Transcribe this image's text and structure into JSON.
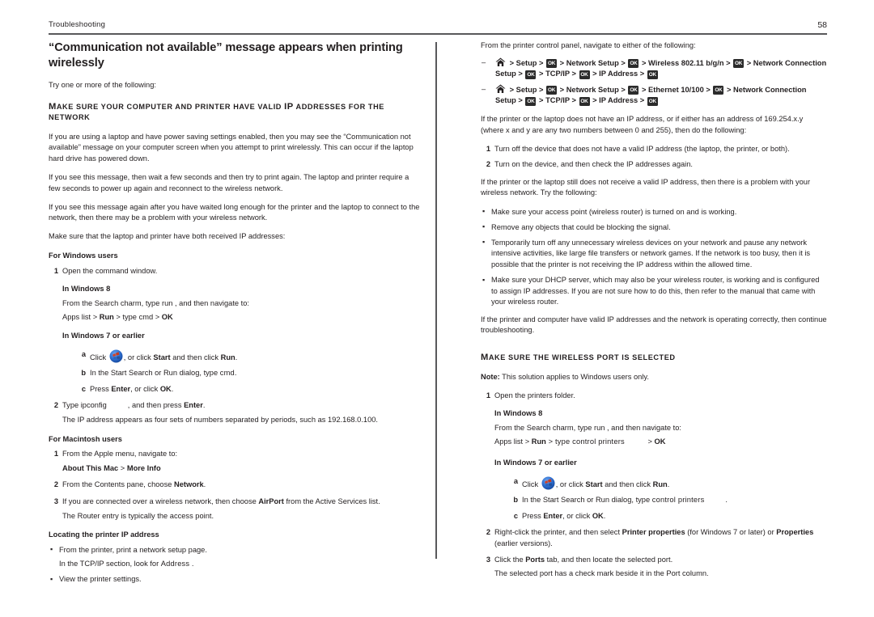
{
  "header": {
    "section": "Troubleshooting",
    "page_number": "58"
  },
  "left_column": {
    "title": "“Communication not available” message appears when printing wirelessly",
    "intro": "Try one or more of the following:",
    "section_heading": {
      "m": "M",
      "rest": "AKE SURE YOUR COMPUTER AND PRINTER HAVE VALID ",
      "ip": "IP",
      "tail": " ADDRESSES FOR THE NETWORK"
    },
    "paragraphs": [
      "If you are using a laptop and have power saving settings enabled, then you may see the “Communication not available” message on your computer screen when you attempt to print wirelessly. This can occur if the laptop hard drive has powered down.",
      "If you see this message, then wait a few seconds and then try to print again. The laptop and printer require a few seconds to power up again and reconnect to the wireless network.",
      "If you see this message again after you have waited long enough for the printer and the laptop to connect to the network, then there may be a problem with your wireless network.",
      "Make sure that the laptop and printer have both received IP addresses:"
    ],
    "windows_users": {
      "heading": "For Windows users",
      "step1_marker": "1",
      "step1": "Open the command window.",
      "win8_heading": "In Windows 8",
      "win8_line1": "From the Search charm, type run , and then navigate to:",
      "win8_line2_pre": "Apps list > ",
      "win8_run": "Run",
      "win8_line2_mid": " > type cmd > ",
      "win8_ok": "OK",
      "win7_heading": "In Windows 7 or earlier",
      "a_marker": "a",
      "a_pre": "Click ",
      "a_mid": ", or click ",
      "a_start": "Start",
      "a_mid2": " and then click ",
      "a_run": "Run",
      "a_end": ".",
      "b_marker": "b",
      "b_text_pre": "In the Start Search or Run dialog, type ",
      "b_cmd": "cmd",
      "b_text_post": ".",
      "c_marker": "c",
      "c_pre": "Press ",
      "c_enter": "Enter",
      "c_mid": ", or click ",
      "c_ok": "OK",
      "c_end": ".",
      "step2_marker": "2",
      "step2_pre": "Type ipconfig",
      "step2_mid": ", and then press ",
      "step2_enter": "Enter",
      "step2_end": ".",
      "step2_note": "The IP address appears as four sets of numbers separated by periods, such as 192.168.0.100."
    },
    "macintosh_users": {
      "heading": "For Macintosh users",
      "step1_marker": "1",
      "step1": "From the Apple menu, navigate to:",
      "step1_path_a": "About This Mac",
      "step1_path_sep": " > ",
      "step1_path_b": "More Info",
      "step2_marker": "2",
      "step2_pre": "From the Contents pane, choose ",
      "step2_bold": "Network",
      "step2_end": ".",
      "step3_marker": "3",
      "step3_pre": "If you are connected over a wireless network, then choose ",
      "step3_bold": "AirPort",
      "step3_post": " from the Active Services list.",
      "step3_note": "The Router entry is typically the access point."
    },
    "locating_ip": {
      "heading": "Locating the printer IP address",
      "bullet1": "From the printer, print a network setup page.",
      "bullet1_note_pre": "In the TCP/IP section, look for ",
      "bullet1_note_val": "Address",
      "bullet1_note_post": " .",
      "bullet2": "View the printer settings."
    }
  },
  "right_column": {
    "intro": "From the printer control panel, navigate to either of the following:",
    "nav_paths": [
      {
        "dash": "–",
        "segments": [
          "Setup",
          "Network Setup",
          "Wireless 802.11 b/g/n",
          "Network Connection Setup",
          "TCP/IP",
          "IP Address"
        ]
      },
      {
        "dash": "–",
        "segments": [
          "Setup",
          "Network Setup",
          "Ethernet 10/100",
          "Network Connection Setup",
          "TCP/IP",
          "IP Address"
        ]
      }
    ],
    "sep": ">",
    "ok_label": "OK",
    "ip_para": "If the printer or the laptop does not have an IP address, or if either has an address of 169.254.x.y (where x and y are any two numbers between 0 and 255), then do the following:",
    "steps": [
      {
        "marker": "1",
        "text": "Turn off the device that does not have a valid IP address (the laptop, the printer, or both)."
      },
      {
        "marker": "2",
        "text": "Turn on the device, and then check the IP addresses again."
      }
    ],
    "still_para": "If the printer or the laptop still does not receive a valid IP address, then there is a problem with your wireless network. Try the following:",
    "bullets": [
      "Make sure your access point (wireless router) is turned on and is working.",
      "Remove any objects that could be blocking the signal.",
      "Temporarily turn off any unnecessary wireless devices on your network and pause any network intensive activities, like large file transfers or network games. If the network is too busy, then it is possible that the printer is not receiving the IP address within the allowed time.",
      "Make sure your DHCP server, which may also be your wireless router, is working and is configured to assign IP addresses. If you are not sure how to do this, then refer to the manual that came with your wireless router."
    ],
    "closing_para": "If the printer and computer have valid IP addresses and the network is operating correctly, then continue troubleshooting.",
    "section_heading": {
      "m": "M",
      "rest": "AKE SURE THE WIRELESS PORT IS SELECTED"
    },
    "note_label": "Note:",
    "note_text": " This solution applies to Windows users only.",
    "port_steps": {
      "step1_marker": "1",
      "step1": "Open the printers folder.",
      "win8_heading": "In Windows 8",
      "win8_line1": "From the Search charm, type run , and then navigate to:",
      "win8_line2_pre": "Apps list > ",
      "win8_run": "Run",
      "win8_line2_mid": " > type control printers",
      "win8_line2_tail": " > ",
      "win8_ok": "OK",
      "win7_heading": "In Windows 7 or earlier",
      "a_marker": "a",
      "a_pre": "Click ",
      "a_mid": ", or click ",
      "a_start": "Start",
      "a_mid2": " and then click ",
      "a_run": "Run",
      "a_end": ".",
      "b_marker": "b",
      "b_text_pre": "In the Start Search or Run dialog, type ",
      "b_cmd": "control printers",
      "b_text_post": ".",
      "c_marker": "c",
      "c_pre": "Press ",
      "c_enter": "Enter",
      "c_mid": ", or click ",
      "c_ok": "OK",
      "c_end": ".",
      "step2_marker": "2",
      "step2_pre": "Right-click the printer, and then select ",
      "step2_bold1": "Printer properties",
      "step2_mid": " (for Windows 7 or later) or ",
      "step2_bold2": "Properties",
      "step2_end": " (earlier versions).",
      "step3_marker": "3",
      "step3_pre": "Click the ",
      "step3_bold": "Ports",
      "step3_post": " tab, and then locate the selected port.",
      "step3_note": "The selected port has a check mark beside it in the Port column."
    }
  },
  "colors": {
    "text": "#231f20",
    "rule": "#58585b",
    "key_bg": "#2b2b2b",
    "orb_blue": "#1f63c8",
    "orb_red": "#d4401f"
  }
}
